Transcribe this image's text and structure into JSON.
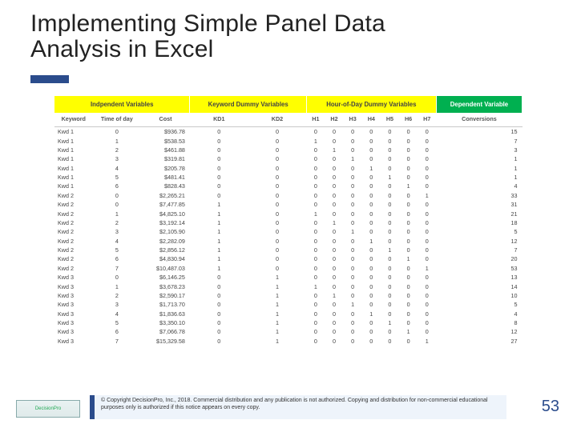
{
  "title": {
    "line1": "Implementing Simple Panel Data",
    "line2": "Analysis in Excel"
  },
  "table": {
    "groups": [
      "Indpendent Variables",
      "Keyword Dummy Variables",
      "Hour-of-Day Dummy Variables",
      "Dependent Variable"
    ],
    "cols": [
      "Keyword",
      "Time of day",
      "Cost",
      "KD1",
      "KD2",
      "H1",
      "H2",
      "H3",
      "H4",
      "H5",
      "H6",
      "H7",
      "Conversions"
    ],
    "rows": [
      [
        "Kwd 1",
        "0",
        "$936.78",
        "0",
        "0",
        "0",
        "0",
        "0",
        "0",
        "0",
        "0",
        "0",
        "15"
      ],
      [
        "Kwd 1",
        "1",
        "$538.53",
        "0",
        "0",
        "1",
        "0",
        "0",
        "0",
        "0",
        "0",
        "0",
        "7"
      ],
      [
        "Kwd 1",
        "2",
        "$461.88",
        "0",
        "0",
        "0",
        "1",
        "0",
        "0",
        "0",
        "0",
        "0",
        "3"
      ],
      [
        "Kwd 1",
        "3",
        "$319.81",
        "0",
        "0",
        "0",
        "0",
        "1",
        "0",
        "0",
        "0",
        "0",
        "1"
      ],
      [
        "Kwd 1",
        "4",
        "$205.78",
        "0",
        "0",
        "0",
        "0",
        "0",
        "1",
        "0",
        "0",
        "0",
        "1"
      ],
      [
        "Kwd 1",
        "5",
        "$481.41",
        "0",
        "0",
        "0",
        "0",
        "0",
        "0",
        "1",
        "0",
        "0",
        "1"
      ],
      [
        "Kwd 1",
        "6",
        "$828.43",
        "0",
        "0",
        "0",
        "0",
        "0",
        "0",
        "0",
        "1",
        "0",
        "4"
      ],
      [
        "Kwd 2",
        "0",
        "$2,265.21",
        "0",
        "0",
        "0",
        "0",
        "0",
        "0",
        "0",
        "0",
        "1",
        "33"
      ],
      [
        "Kwd 2",
        "0",
        "$7,477.85",
        "1",
        "0",
        "0",
        "0",
        "0",
        "0",
        "0",
        "0",
        "0",
        "31"
      ],
      [
        "Kwd 2",
        "1",
        "$4,825.10",
        "1",
        "0",
        "1",
        "0",
        "0",
        "0",
        "0",
        "0",
        "0",
        "21"
      ],
      [
        "Kwd 2",
        "2",
        "$3,192.14",
        "1",
        "0",
        "0",
        "1",
        "0",
        "0",
        "0",
        "0",
        "0",
        "18"
      ],
      [
        "Kwd 2",
        "3",
        "$2,105.90",
        "1",
        "0",
        "0",
        "0",
        "1",
        "0",
        "0",
        "0",
        "0",
        "5"
      ],
      [
        "Kwd 2",
        "4",
        "$2,282.09",
        "1",
        "0",
        "0",
        "0",
        "0",
        "1",
        "0",
        "0",
        "0",
        "12"
      ],
      [
        "Kwd 2",
        "5",
        "$2,856.12",
        "1",
        "0",
        "0",
        "0",
        "0",
        "0",
        "1",
        "0",
        "0",
        "7"
      ],
      [
        "Kwd 2",
        "6",
        "$4,830.94",
        "1",
        "0",
        "0",
        "0",
        "0",
        "0",
        "0",
        "1",
        "0",
        "20"
      ],
      [
        "Kwd 2",
        "7",
        "$10,487.03",
        "1",
        "0",
        "0",
        "0",
        "0",
        "0",
        "0",
        "0",
        "1",
        "53"
      ],
      [
        "Kwd 3",
        "0",
        "$6,146.25",
        "0",
        "1",
        "0",
        "0",
        "0",
        "0",
        "0",
        "0",
        "0",
        "13"
      ],
      [
        "Kwd 3",
        "1",
        "$3,678.23",
        "0",
        "1",
        "1",
        "0",
        "0",
        "0",
        "0",
        "0",
        "0",
        "14"
      ],
      [
        "Kwd 3",
        "2",
        "$2,590.17",
        "0",
        "1",
        "0",
        "1",
        "0",
        "0",
        "0",
        "0",
        "0",
        "10"
      ],
      [
        "Kwd 3",
        "3",
        "$1,713.70",
        "0",
        "1",
        "0",
        "0",
        "1",
        "0",
        "0",
        "0",
        "0",
        "5"
      ],
      [
        "Kwd 3",
        "4",
        "$1,836.63",
        "0",
        "1",
        "0",
        "0",
        "0",
        "1",
        "0",
        "0",
        "0",
        "4"
      ],
      [
        "Kwd 3",
        "5",
        "$3,350.10",
        "0",
        "1",
        "0",
        "0",
        "0",
        "0",
        "1",
        "0",
        "0",
        "8"
      ],
      [
        "Kwd 3",
        "6",
        "$7,066.78",
        "0",
        "1",
        "0",
        "0",
        "0",
        "0",
        "0",
        "1",
        "0",
        "12"
      ],
      [
        "Kwd 3",
        "7",
        "$15,329.58",
        "0",
        "1",
        "0",
        "0",
        "0",
        "0",
        "0",
        "0",
        "1",
        "27"
      ]
    ]
  },
  "footer": {
    "logo": "DecisionPro",
    "copyright": "© Copyright DecisionPro, Inc., 2018. Commercial distribution and any publication is not authorized. Copying and distribution for non-commercial educational purposes only is authorized if this notice appears on every copy.",
    "page": "53"
  }
}
